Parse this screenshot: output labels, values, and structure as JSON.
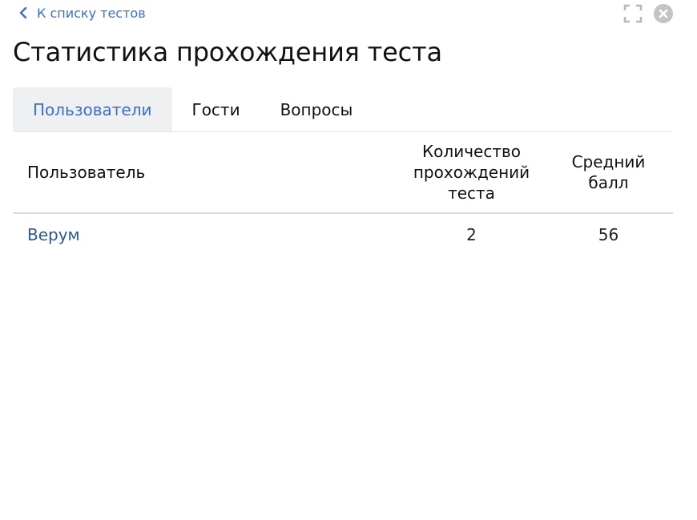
{
  "header": {
    "back_label": "К списку тестов",
    "title": "Статистика прохождения теста",
    "icons": [
      "fullscreen-icon",
      "close-icon"
    ]
  },
  "tabs": [
    {
      "label": "Пользователи",
      "active": true
    },
    {
      "label": "Гости",
      "active": false
    },
    {
      "label": "Вопросы",
      "active": false
    }
  ],
  "table": {
    "columns": [
      "Пользователь",
      "Количество прохождений теста",
      "Средний балл"
    ],
    "rows": [
      {
        "user": "Верум",
        "attempts": "2",
        "avg_score": "56"
      }
    ]
  },
  "colors": {
    "accent": "#3a6fd0",
    "link": "#2c5a94",
    "active_tab_bg": "#eef0f2"
  }
}
